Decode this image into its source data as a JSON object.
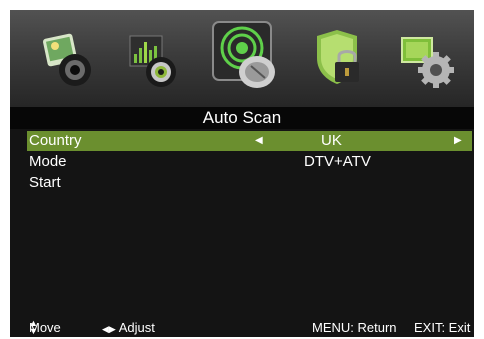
{
  "menu_icons": [
    {
      "name": "picture-icon"
    },
    {
      "name": "sound-icon"
    },
    {
      "name": "channel-icon"
    },
    {
      "name": "lock-icon"
    },
    {
      "name": "setup-icon"
    }
  ],
  "title": "Auto Scan",
  "rows": [
    {
      "label": "Country",
      "value": "UK"
    },
    {
      "label": "Mode",
      "value": "DTV+ATV"
    },
    {
      "label": "Start",
      "value": ""
    }
  ],
  "footer": {
    "move": "Move",
    "adjust": "Adjust",
    "menu": "MENU: Return",
    "exit": "EXIT: Exit"
  },
  "colors": {
    "selected_row": "#6b8f2f",
    "background": "#141414",
    "title_bar": "#070707"
  }
}
